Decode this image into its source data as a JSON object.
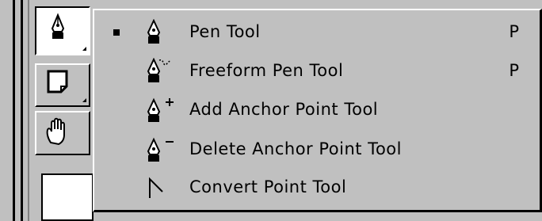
{
  "toolbox": {
    "tools": [
      {
        "name": "pen-tool",
        "pressed": true
      },
      {
        "name": "note-tool",
        "pressed": false
      },
      {
        "name": "hand-tool",
        "pressed": false
      }
    ]
  },
  "menu": {
    "items": [
      {
        "label": "Pen Tool",
        "shortcut": "P",
        "checked": true,
        "icon": "pen-icon"
      },
      {
        "label": "Freeform Pen Tool",
        "shortcut": "P",
        "checked": false,
        "icon": "freeform-pen-icon"
      },
      {
        "label": "Add Anchor Point Tool",
        "shortcut": "",
        "checked": false,
        "icon": "add-anchor-point-icon"
      },
      {
        "label": "Delete Anchor Point Tool",
        "shortcut": "",
        "checked": false,
        "icon": "delete-anchor-point-icon"
      },
      {
        "label": "Convert Point Tool",
        "shortcut": "",
        "checked": false,
        "icon": "convert-point-icon"
      }
    ]
  }
}
